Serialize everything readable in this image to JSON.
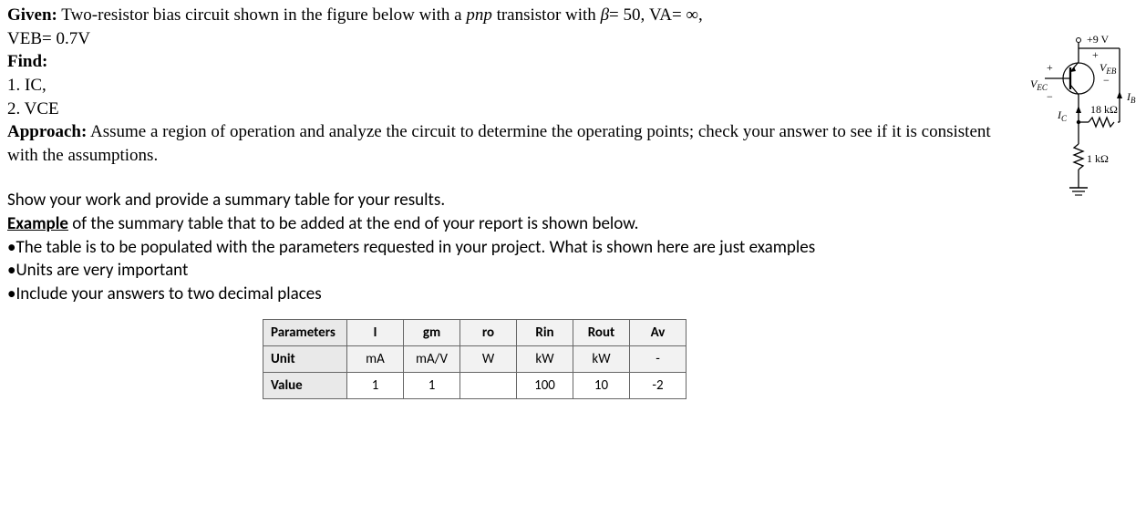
{
  "given": {
    "label": "Given:",
    "text_before_italic": " Two-resistor bias circuit shown in the figure below with a ",
    "italic_word": "pnp",
    "text_after_italic": " transistor with ",
    "beta_text": "β",
    "beta_eq": "= 50, VA= ∞,",
    "line2": "VEB= 0.7V"
  },
  "find": {
    "label": "Find:",
    "item1": "1. IC,",
    "item2": "2. VCE"
  },
  "approach": {
    "label": "Approach:",
    "text": " Assume a region of operation and analyze the circuit to determine the operating points; check your answer to see if it is consistent with the assumptions."
  },
  "instructions": {
    "line1": "Show your work and provide a summary table for your results.",
    "example_label": "Example",
    "line2_rest": " of the summary table that to be added at the end of your report is shown below.",
    "bullet1": "•The table is to be populated with the parameters requested in your project. What is shown here are just examples",
    "bullet2": "•Units are very important",
    "bullet3": "•Include your answers to two decimal places"
  },
  "table": {
    "headers": [
      "Parameters",
      "I",
      "gm",
      "ro",
      "Rin",
      "Rout",
      "Av"
    ],
    "unit_row": [
      "Unit",
      "mA",
      "mA/V",
      "W",
      "kW",
      "kW",
      "-"
    ],
    "value_row": [
      "Value",
      "1",
      "1",
      "",
      "100",
      "10",
      "-2"
    ]
  },
  "circuit": {
    "supply": "+9 V",
    "veb_plus": "+",
    "veb_minus": "−",
    "veb_label": "V",
    "veb_sub": "EB",
    "vec_label": "V",
    "vec_sub": "EC",
    "ic_label": "I",
    "ic_sub": "C",
    "ib_label": "I",
    "ib_sub": "B",
    "rb": "18 kΩ",
    "rc": "1 kΩ"
  }
}
